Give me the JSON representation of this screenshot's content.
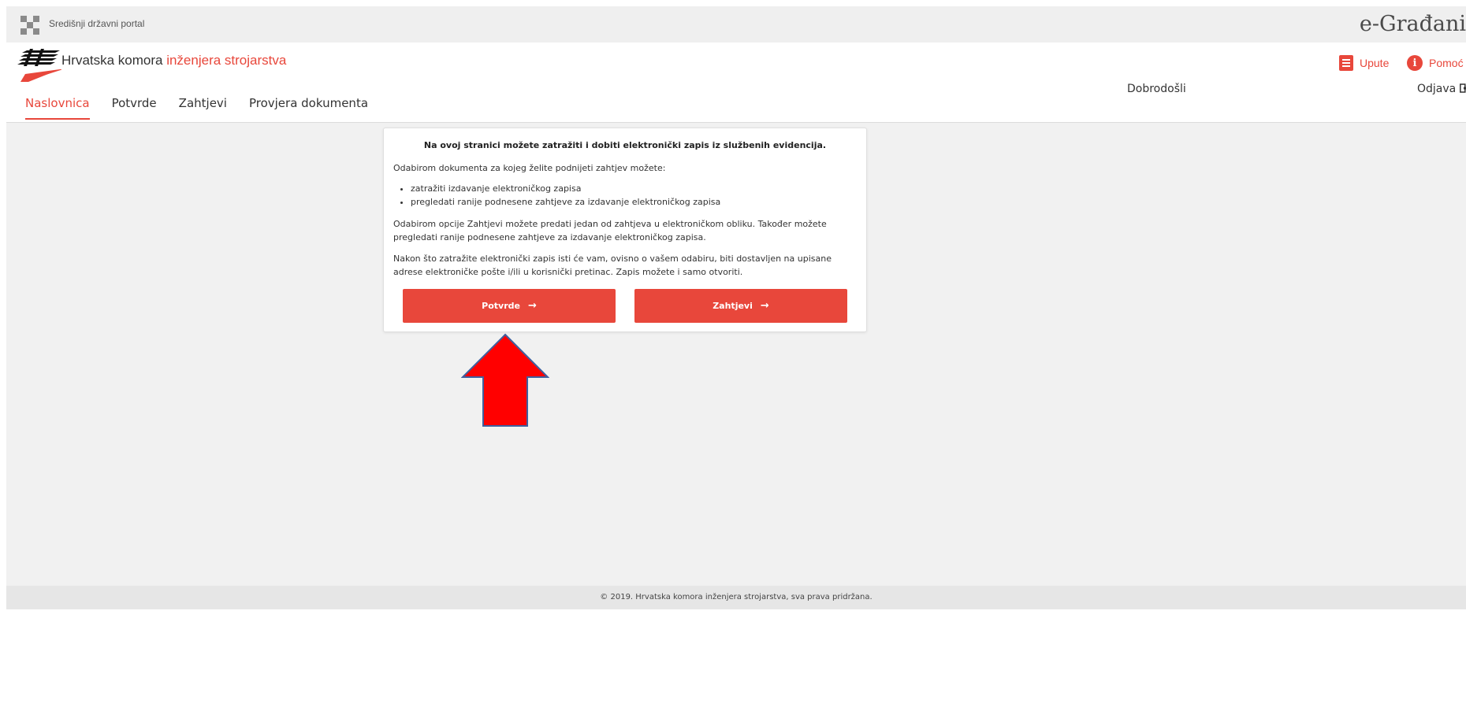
{
  "gov_bar": {
    "portal_label": "Središnji državni portal",
    "brand": "e-Građani"
  },
  "header": {
    "org_name_part1": "Hrvatska komora ",
    "org_name_part2": "inženjera strojarstva",
    "links": {
      "upute": "Upute",
      "pomoc": "Pomoć"
    },
    "welcome": "Dobrodošli",
    "logout": "Odjava"
  },
  "nav": {
    "items": [
      {
        "label": "Naslovnica",
        "active": true
      },
      {
        "label": "Potvrde",
        "active": false
      },
      {
        "label": "Zahtjevi",
        "active": false
      },
      {
        "label": "Provjera dokumenta",
        "active": false
      }
    ]
  },
  "card": {
    "title": "Na ovoj stranici možete zatražiti i dobiti elektronički zapis iz službenih evidencija.",
    "intro": "Odabirom dokumenta za kojeg želite podnijeti zahtjev možete:",
    "bullets": [
      "zatražiti izdavanje elektroničkog zapisa",
      "pregledati ranije podnesene zahtjeve za izdavanje elektroničkog zapisa"
    ],
    "paragraph2": "Odabirom opcije Zahtjevi možete predati jedan od zahtjeva u elektroničkom obliku. Također možete pregledati ranije podnesene zahtjeve za izdavanje elektroničkog zapisa.",
    "paragraph3": "Nakon što zatražite elektronički zapis isti će vam, ovisno o vašem odabiru, biti dostavljen na upisane adrese elektroničke pošte i/ili u korisnički pretinac. Zapis možete i samo otvoriti.",
    "buttons": {
      "potvrde": "Potvrde",
      "zahtjevi": "Zahtjevi"
    },
    "arrow_glyph": "→"
  },
  "footer": {
    "text": "© 2019. Hrvatska komora inženjera strojarstva, sva prava pridržana."
  },
  "colors": {
    "accent": "#e8473b",
    "annotation_arrow": "#ff0000"
  }
}
